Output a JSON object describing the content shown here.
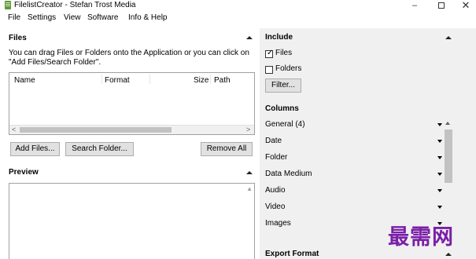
{
  "window": {
    "title": "FilelistCreator - Stefan Trost Media",
    "minimize": "–",
    "close": "✕"
  },
  "menu": [
    "File",
    "Settings",
    "View",
    "Software",
    "Info & Help"
  ],
  "files": {
    "heading": "Files",
    "hint": "You can drag Files or Folders onto the Application or you can click on \"Add Files/Search Folder\".",
    "columns": [
      "Name",
      "Format",
      "Size",
      "Path"
    ],
    "scroll_left": "<",
    "scroll_right": ">",
    "add_files_label": "Add Files...",
    "search_folder_label": "Search Folder...",
    "remove_all_label": "Remove All"
  },
  "preview": {
    "heading": "Preview"
  },
  "include": {
    "heading": "Include",
    "files_label": "Files",
    "files_checked": true,
    "folders_label": "Folders",
    "folders_checked": false,
    "filter_label": "Filter..."
  },
  "columns_section": {
    "heading": "Columns",
    "items": [
      "General (4)",
      "Date",
      "Folder",
      "Data Medium",
      "Audio",
      "Video",
      "Images"
    ]
  },
  "export": {
    "heading": "Export Format"
  },
  "watermark": "最需网",
  "check_mark": "✓",
  "icons": {
    "app": "app-icon",
    "collapse": "collapse-arrow-icon",
    "dropdown": "dropdown-arrow-icon"
  }
}
